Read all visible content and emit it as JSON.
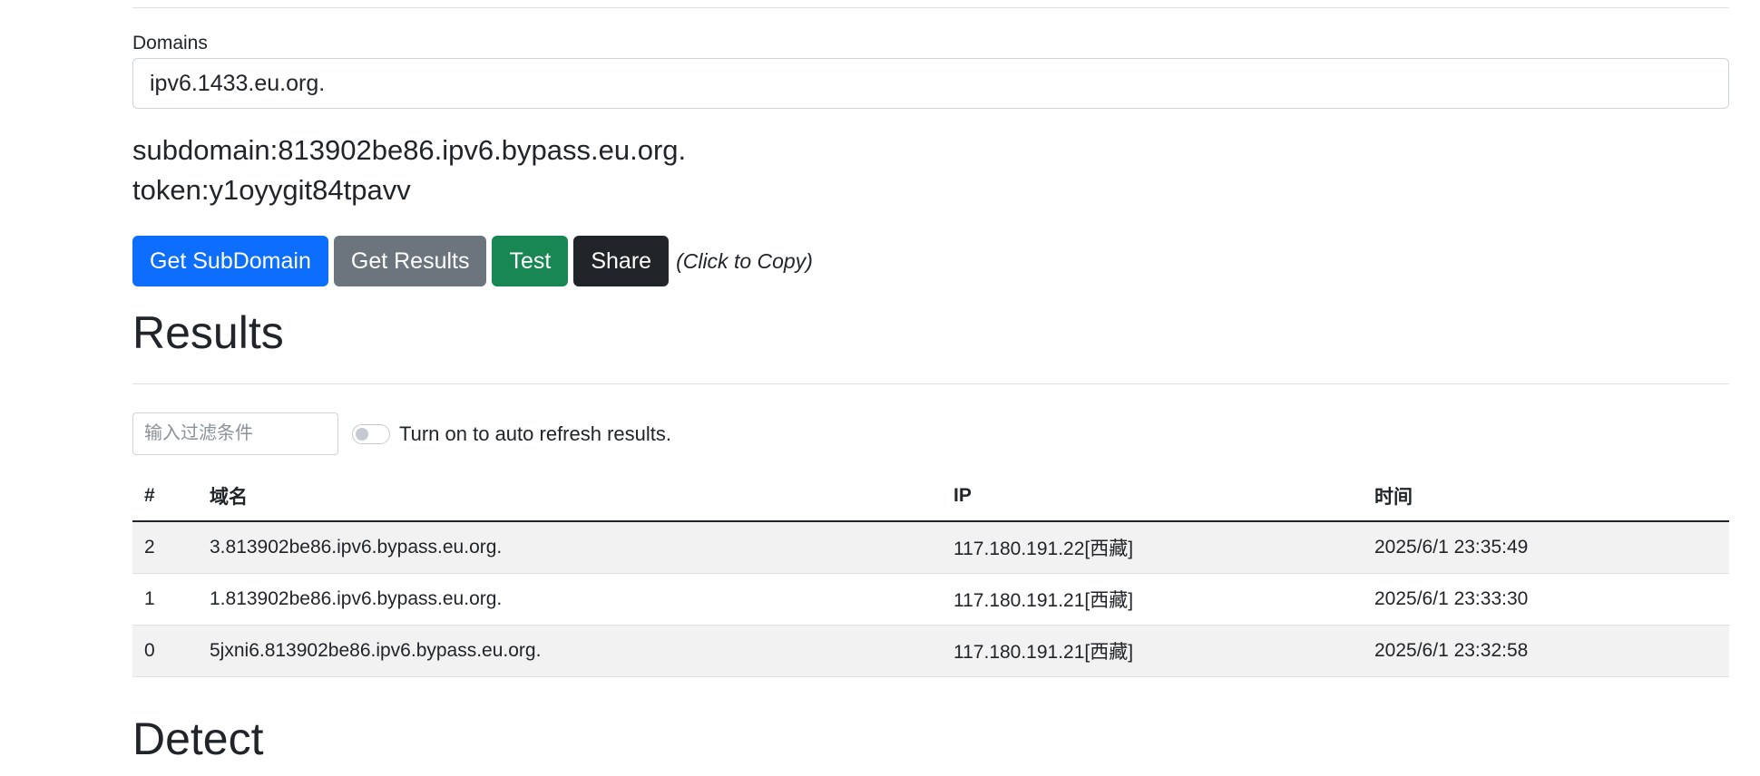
{
  "form": {
    "domains_label": "Domains",
    "domains_value": "ipv6.1433.eu.org."
  },
  "info": {
    "subdomain": "subdomain:813902be86.ipv6.bypass.eu.org.",
    "token": "token:y1oyygit84tpavv"
  },
  "buttons": {
    "get_subdomain": "Get SubDomain",
    "get_results": "Get Results",
    "test": "Test",
    "share": "Share",
    "copy_hint": "(Click to Copy)"
  },
  "results": {
    "heading": "Results",
    "filter_placeholder": "输入过滤条件",
    "auto_refresh_label": "Turn on to auto refresh results.",
    "auto_refresh_on": false,
    "columns": [
      "#",
      "域名",
      "IP",
      "时间"
    ],
    "rows": [
      [
        "2",
        "3.813902be86.ipv6.bypass.eu.org.",
        "117.180.191.22[西藏]",
        "2025/6/1 23:35:49"
      ],
      [
        "1",
        "1.813902be86.ipv6.bypass.eu.org.",
        "117.180.191.21[西藏]",
        "2025/6/1 23:33:30"
      ],
      [
        "0",
        "5jxni6.813902be86.ipv6.bypass.eu.org.",
        "117.180.191.21[西藏]",
        "2025/6/1 23:32:58"
      ]
    ]
  },
  "detect": {
    "heading": "Detect"
  },
  "colors": {
    "primary": "#0d6efd",
    "secondary": "#6c757d",
    "success": "#198754",
    "dark": "#212529",
    "striped_row": "#f2f2f2"
  }
}
